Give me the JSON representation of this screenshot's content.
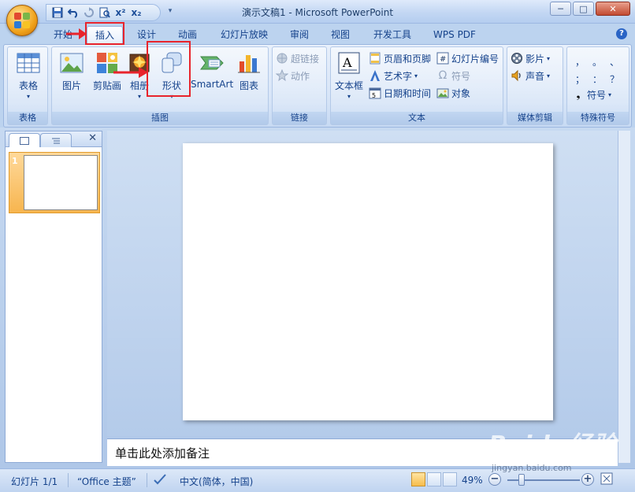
{
  "window": {
    "title": "演示文稿1 - Microsoft PowerPoint",
    "min_label": "─",
    "max_label": "□",
    "close_label": "✕"
  },
  "qat": {
    "save": "save-icon",
    "undo": "undo-icon",
    "redo": "redo-icon",
    "print_preview": "print-preview-icon",
    "superscript_label": "x²",
    "subscript_label": "x₂",
    "more": "▾"
  },
  "tabs": [
    {
      "label": "开始",
      "active": false
    },
    {
      "label": "插入",
      "active": true
    },
    {
      "label": "设计",
      "active": false
    },
    {
      "label": "动画",
      "active": false
    },
    {
      "label": "幻灯片放映",
      "active": false
    },
    {
      "label": "审阅",
      "active": false
    },
    {
      "label": "视图",
      "active": false
    },
    {
      "label": "开发工具",
      "active": false
    },
    {
      "label": "WPS PDF",
      "active": false
    }
  ],
  "ribbon": {
    "groups": {
      "table": {
        "label": "表格",
        "table_btn": "表格"
      },
      "illustrations": {
        "label": "插图",
        "picture_btn": "图片",
        "clipart_btn": "剪贴画",
        "album_btn": "相册",
        "shapes_btn": "形状",
        "smartart_btn": "SmartArt",
        "chart_btn": "图表"
      },
      "links": {
        "label": "链接",
        "hyperlink_btn": "超链接",
        "action_btn": "动作"
      },
      "text": {
        "label": "文本",
        "textbox_btn": "文本框",
        "header_footer_btn": "页眉和页脚",
        "wordart_btn": "艺术字",
        "datetime_btn": "日期和时间",
        "slide_number_btn": "幻灯片编号",
        "symbol_btn": "符号",
        "object_btn": "对象"
      },
      "media": {
        "label": "媒体剪辑",
        "movie_btn": "影片",
        "sound_btn": "声音"
      },
      "special": {
        "label": "特殊符号",
        "sym1": "，",
        "sym2": "。",
        "sym3": "、",
        "sym4": "；",
        "sym5": "：",
        "sym6": "？",
        "symbol_btn": "符号"
      }
    }
  },
  "slides_panel": {
    "slide_number": "1",
    "close": "✕"
  },
  "notes": {
    "placeholder": "单击此处添加备注"
  },
  "status": {
    "slide_info": "幻灯片 1/1",
    "theme": "“Office 主题”",
    "language": "中文(简体，中国)",
    "zoom": "49%"
  },
  "colors": {
    "highlight": "#e8242c",
    "accent": "#15428b"
  },
  "watermark": {
    "text": "Baidu经验",
    "url": "jingyan.baidu.com"
  }
}
